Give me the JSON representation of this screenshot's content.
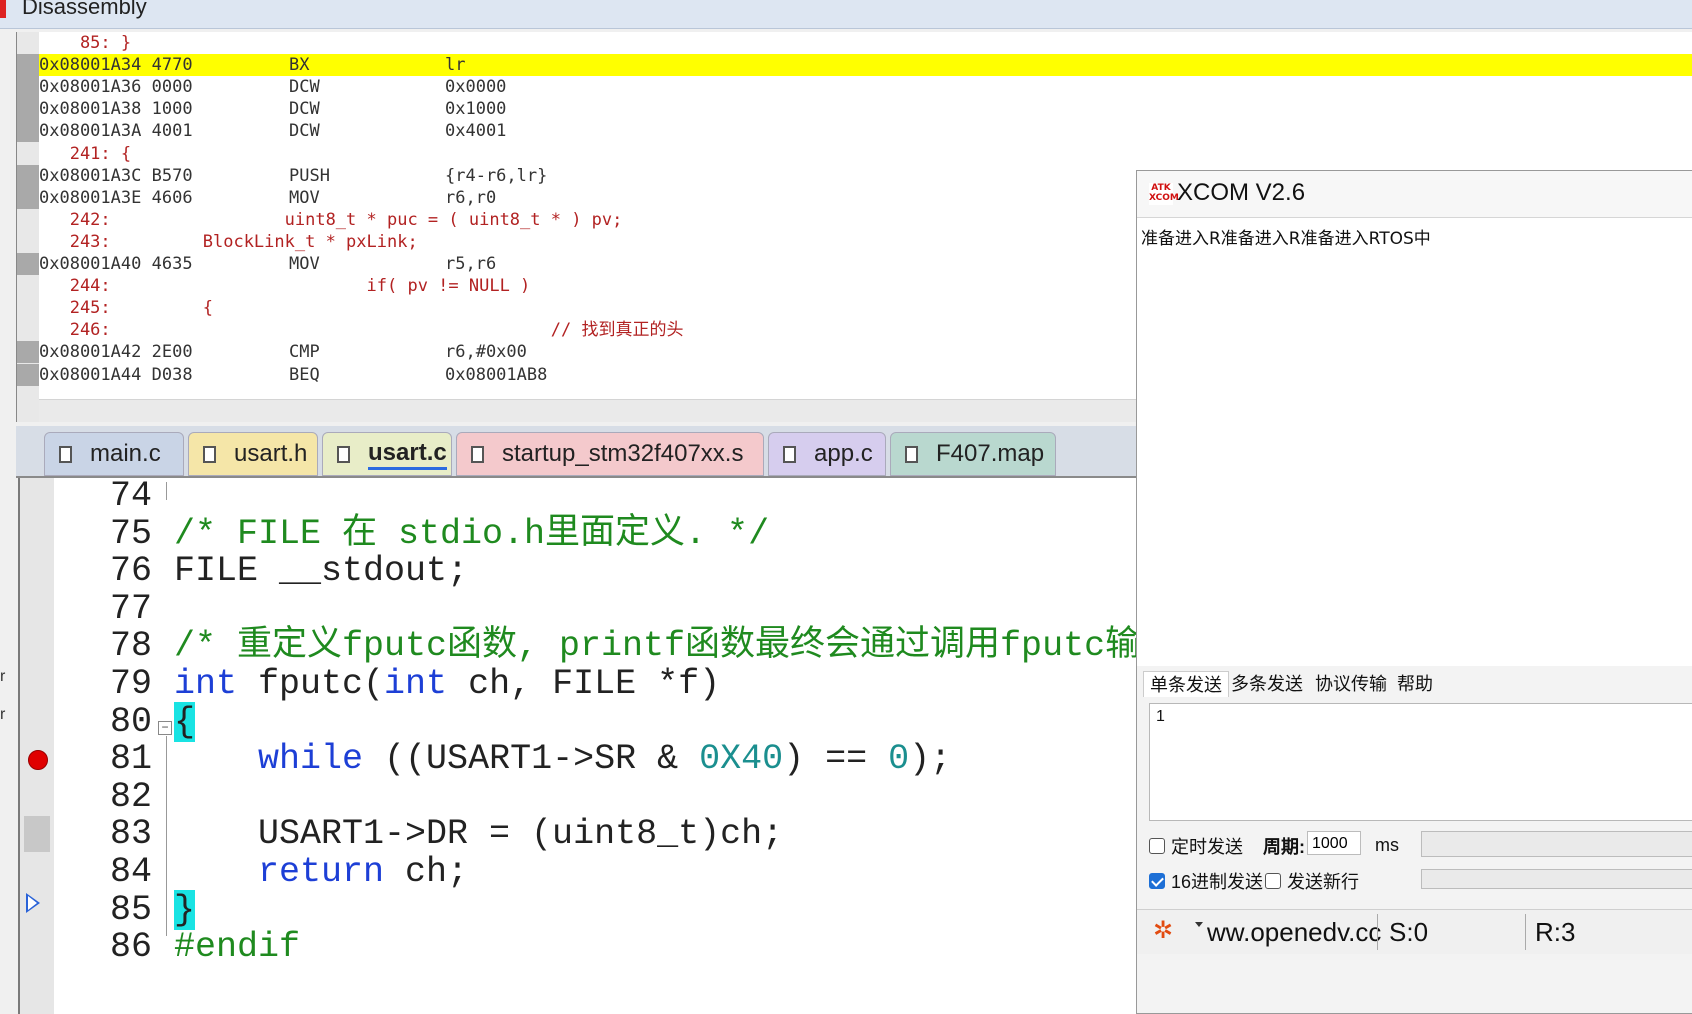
{
  "disassembly": {
    "title": "Disassembly",
    "lines": [
      {
        "kind": "src",
        "text": "    85: }"
      },
      {
        "kind": "asm",
        "addr": "0x08001A34",
        "code": "4770",
        "mn": "BX",
        "op": "lr",
        "current": true
      },
      {
        "kind": "asm",
        "addr": "0x08001A36",
        "code": "0000",
        "mn": "DCW",
        "op": "0x0000"
      },
      {
        "kind": "asm",
        "addr": "0x08001A38",
        "code": "1000",
        "mn": "DCW",
        "op": "0x1000"
      },
      {
        "kind": "asm",
        "addr": "0x08001A3A",
        "code": "4001",
        "mn": "DCW",
        "op": "0x4001"
      },
      {
        "kind": "src",
        "text": "   241: {"
      },
      {
        "kind": "asm",
        "addr": "0x08001A3C",
        "code": "B570",
        "mn": "PUSH",
        "op": "{r4-r6,lr}"
      },
      {
        "kind": "asm",
        "addr": "0x08001A3E",
        "code": "4606",
        "mn": "MOV",
        "op": "r6,r0"
      },
      {
        "kind": "src",
        "text": "   242:                 uint8_t * puc = ( uint8_t * ) pv;"
      },
      {
        "kind": "src",
        "text": "   243:         BlockLink_t * pxLink;"
      },
      {
        "kind": "asm",
        "addr": "0x08001A40",
        "code": "4635",
        "mn": "MOV",
        "op": "r5,r6"
      },
      {
        "kind": "src",
        "text": "   244:                         if( pv != NULL )"
      },
      {
        "kind": "src",
        "text": "   245:         {"
      },
      {
        "kind": "src",
        "text": "   246:                                           // 找到真正的头"
      },
      {
        "kind": "asm",
        "addr": "0x08001A42",
        "code": "2E00",
        "mn": "CMP",
        "op": "r6,#0x00"
      },
      {
        "kind": "asm",
        "addr": "0x08001A44",
        "code": "D038",
        "mn": "BEQ",
        "op": "0x08001AB8"
      }
    ]
  },
  "tabs": [
    {
      "label": "main.c",
      "color": "#c9d4e6",
      "active": false
    },
    {
      "label": "usart.h",
      "color": "#f5e6a8",
      "active": false
    },
    {
      "label": "usart.c",
      "color": "#e8edc8",
      "active": true
    },
    {
      "label": "startup_stm32f407xx.s",
      "color": "#f4c9cc",
      "active": false
    },
    {
      "label": "app.c",
      "color": "#d6cdee",
      "active": false
    },
    {
      "label": "F407.map",
      "color": "#b9d8cf",
      "active": false
    }
  ],
  "editor": {
    "lines": [
      {
        "n": "74",
        "parts": []
      },
      {
        "n": "75",
        "parts": [
          {
            "t": "/* FILE 在 stdio.h里面定义. */",
            "c": "cmt"
          }
        ]
      },
      {
        "n": "76",
        "parts": [
          {
            "t": "FILE __stdout;",
            "c": ""
          }
        ]
      },
      {
        "n": "77",
        "parts": []
      },
      {
        "n": "78",
        "parts": [
          {
            "t": "/* 重定义fputc函数, printf函数最终会通过调用fputc输",
            "c": "cmt"
          }
        ]
      },
      {
        "n": "79",
        "parts": [
          {
            "t": "int",
            "c": "kw"
          },
          {
            "t": " fputc(",
            "c": ""
          },
          {
            "t": "int",
            "c": "kw"
          },
          {
            "t": " ch, FILE *f)",
            "c": ""
          }
        ]
      },
      {
        "n": "80",
        "parts": [
          {
            "t": "{",
            "c": "brace"
          }
        ]
      },
      {
        "n": "81",
        "parts": [
          {
            "t": "    ",
            "c": ""
          },
          {
            "t": "while",
            "c": "kw"
          },
          {
            "t": " ((USART1->SR & ",
            "c": ""
          },
          {
            "t": "0X40",
            "c": "num"
          },
          {
            "t": ") == ",
            "c": ""
          },
          {
            "t": "0",
            "c": "num"
          },
          {
            "t": ");",
            "c": ""
          }
        ]
      },
      {
        "n": "82",
        "parts": []
      },
      {
        "n": "83",
        "parts": [
          {
            "t": "    USART1->DR = (uint8_t)ch;",
            "c": ""
          }
        ]
      },
      {
        "n": "84",
        "parts": [
          {
            "t": "    ",
            "c": ""
          },
          {
            "t": "return",
            "c": "kw"
          },
          {
            "t": " ch;",
            "c": ""
          }
        ]
      },
      {
        "n": "85",
        "parts": [
          {
            "t": "}",
            "c": "brace"
          }
        ]
      },
      {
        "n": "86",
        "parts": [
          {
            "t": "#endif",
            "c": "cmt"
          }
        ]
      }
    ]
  },
  "xcom": {
    "title": "XCOM V2.6",
    "logo_text": "ATK XCOM",
    "received": "准备进入R准备进入R准备进入RTOS中",
    "tabs": [
      "单条发送",
      "多条发送",
      "协议传输",
      "帮助"
    ],
    "send_text": "1",
    "timed_send_label": "定时发送",
    "timed_send_checked": false,
    "period_label": "周期:",
    "period_value": "1000",
    "period_unit": "ms",
    "hex_send_label": "16进制发送",
    "hex_send_checked": true,
    "newline_label": "发送新行",
    "newline_checked": false,
    "status_url": "ww.openedv.cc",
    "status_sent": "S:0",
    "status_recv": "R:3"
  },
  "edge_marks": [
    "r",
    "r"
  ]
}
